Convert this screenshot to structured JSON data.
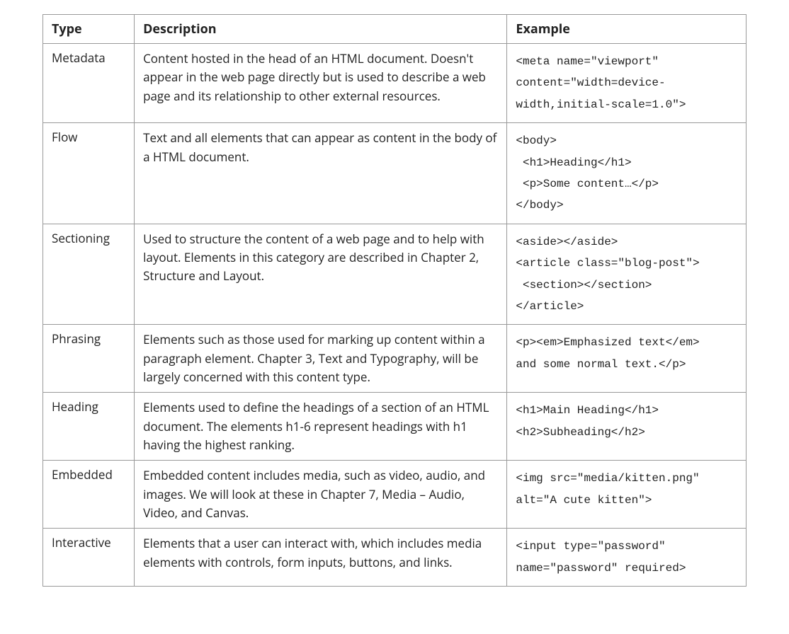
{
  "table": {
    "headers": {
      "type": "Type",
      "description": "Description",
      "example": "Example"
    },
    "rows": [
      {
        "type": "Metadata",
        "description": "Content hosted in the head of an HTML document. Doesn't appear in the web page directly but is used to describe a web page and its relationship to other external resources.",
        "example": "<meta name=\"viewport\"\ncontent=\"width=device-\nwidth,initial-scale=1.0\">"
      },
      {
        "type": "Flow",
        "description": "Text and all elements that can appear as content in the body of a HTML document.",
        "example": "<body>\n <h1>Heading</h1>\n <p>Some content…</p>\n</body>"
      },
      {
        "type": "Sectioning",
        "description": "Used to structure the content of a web page and to help with layout. Elements in this category are described in Chapter 2, Structure and Layout.",
        "example": "<aside></aside>\n<article class=\"blog-post\">\n <section></section>\n</article>"
      },
      {
        "type": "Phrasing",
        "description": "Elements such as those used for marking up content within a paragraph element. Chapter 3, Text and Typography, will be largely concerned with this content type.",
        "example": "<p><em>Emphasized text</em>\nand some normal text.</p>"
      },
      {
        "type": "Heading",
        "description": "Elements used to define the headings of a section of an HTML document. The elements h1-6 represent headings with h1 having the highest ranking.",
        "example": "<h1>Main Heading</h1>\n<h2>Subheading</h2>"
      },
      {
        "type": "Embedded",
        "description": "Embedded content includes media, such as video, audio, and images. We will look at these in Chapter 7, Media – Audio, Video, and Canvas.",
        "example": "<img src=\"media/kitten.png\"\nalt=\"A cute kitten\">"
      },
      {
        "type": "Interactive",
        "description": "Elements that a user can interact with, which includes media elements with controls, form inputs, buttons, and links.",
        "example": "<input type=\"password\"\nname=\"password\" required>"
      }
    ]
  }
}
